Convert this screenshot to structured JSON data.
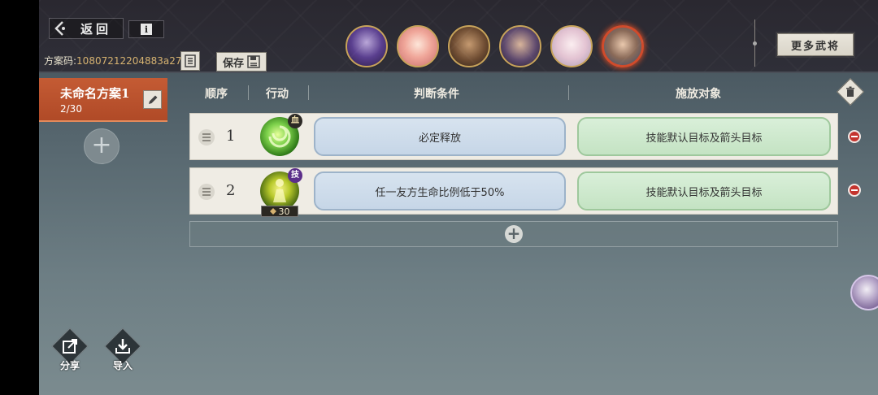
{
  "header": {
    "back_label": "返回",
    "info_label": "i",
    "plan_code_label": "方案码:",
    "plan_code_value": "10807212204883a27",
    "save_label": "保存",
    "more_generals_label": "更多武将"
  },
  "generals": [
    {
      "name": "general-1",
      "selected": false
    },
    {
      "name": "general-2",
      "selected": false
    },
    {
      "name": "general-3",
      "selected": false
    },
    {
      "name": "general-4",
      "selected": false
    },
    {
      "name": "general-5",
      "selected": false
    },
    {
      "name": "general-6",
      "selected": true
    }
  ],
  "sidebar": {
    "plan_name": "未命名方案1",
    "plan_count": "2/30",
    "add_symbol": "+"
  },
  "table": {
    "headers": {
      "order": "顺序",
      "action": "行动",
      "condition": "判断条件",
      "target": "施放对象"
    },
    "rows": [
      {
        "order": "1",
        "skill_badge": "血",
        "condition": "必定释放",
        "target": "技能默认目标及箭头目标"
      },
      {
        "order": "2",
        "skill_badge": "技",
        "skill_cost": "30",
        "condition": "任一友方生命比例低于50%",
        "target": "技能默认目标及箭头目标"
      }
    ],
    "add_symbol": "+"
  },
  "footer": {
    "share_label": "分享",
    "import_label": "导入"
  },
  "colors": {
    "accent_orange": "#c45b34",
    "condition_blue": "#c6d6e7",
    "target_green": "#c4e3c3",
    "delete_red": "#c4342e"
  }
}
